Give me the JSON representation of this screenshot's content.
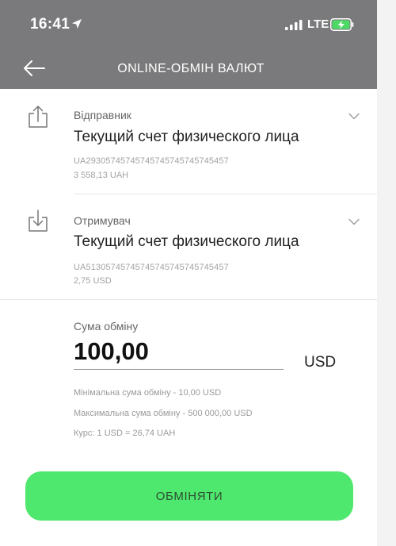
{
  "status_bar": {
    "time": "16:41",
    "network": "LTE",
    "location_icon": "location-arrow-icon",
    "signal_icon": "cellular-signal-icon",
    "battery_icon": "battery-charging-icon",
    "battery_color": "#4cd964"
  },
  "header": {
    "title": "ONLINE-ОБМІН ВАЛЮТ",
    "back_icon": "arrow-left-icon",
    "background": "#7a7a7c"
  },
  "sender": {
    "role_label": "Відправник",
    "account_name": "Текущий счет физического лица",
    "iban": "UA29305745745745745745745745457",
    "balance": "3 558,13 UAH",
    "icon": "upload-icon",
    "expand_icon": "chevron-down-icon"
  },
  "receiver": {
    "role_label": "Отримувач",
    "account_name": "Текущий счет физического лица",
    "iban": "UA51305745745745745745745745457",
    "balance": "2,75 USD",
    "icon": "download-icon",
    "expand_icon": "chevron-down-icon"
  },
  "exchange": {
    "amount_label": "Сума обміну",
    "amount_value": "100,00",
    "currency": "USD",
    "min_amount": "Мінімальна сума обміну - 10,00 USD",
    "max_amount": "Максимальна сума обміну - 500 000,00 USD",
    "rate": "Курс: 1 USD = 26,74 UAH"
  },
  "action": {
    "button_label": "ОБМІНЯТИ",
    "accent_color": "#4fe86e"
  }
}
